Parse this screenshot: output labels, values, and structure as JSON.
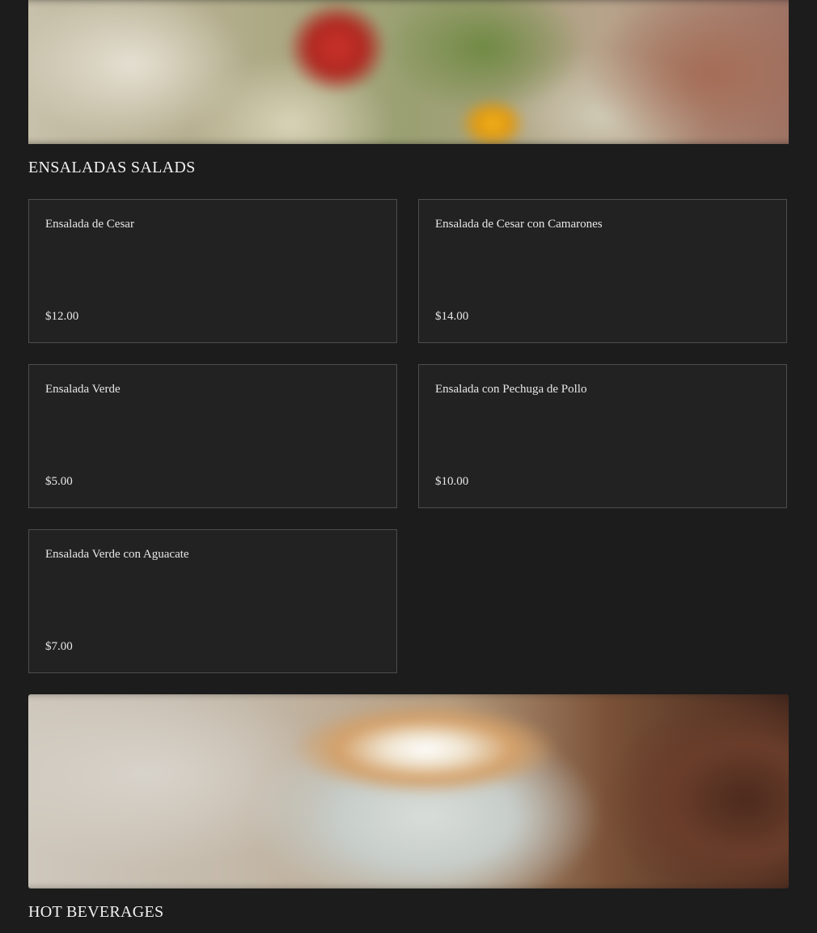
{
  "sections": [
    {
      "title": "ENSALADAS SALADS",
      "banner_image": "salad-photo",
      "items": [
        {
          "name": "Ensalada de Cesar",
          "price": "$12.00"
        },
        {
          "name": "Ensalada de Cesar con Camarones",
          "price": "$14.00"
        },
        {
          "name": "Ensalada Verde",
          "price": "$5.00"
        },
        {
          "name": "Ensalada con Pechuga de Pollo",
          "price": "$10.00"
        },
        {
          "name": "Ensalada Verde con Aguacate",
          "price": "$7.00"
        }
      ]
    },
    {
      "title": "HOT BEVERAGES",
      "banner_image": "coffee-photo",
      "items": []
    }
  ],
  "colors": {
    "background": "#1c1c1c",
    "card_background": "#222222",
    "card_border": "#4d4d4d",
    "text": "#e8e8e8"
  }
}
